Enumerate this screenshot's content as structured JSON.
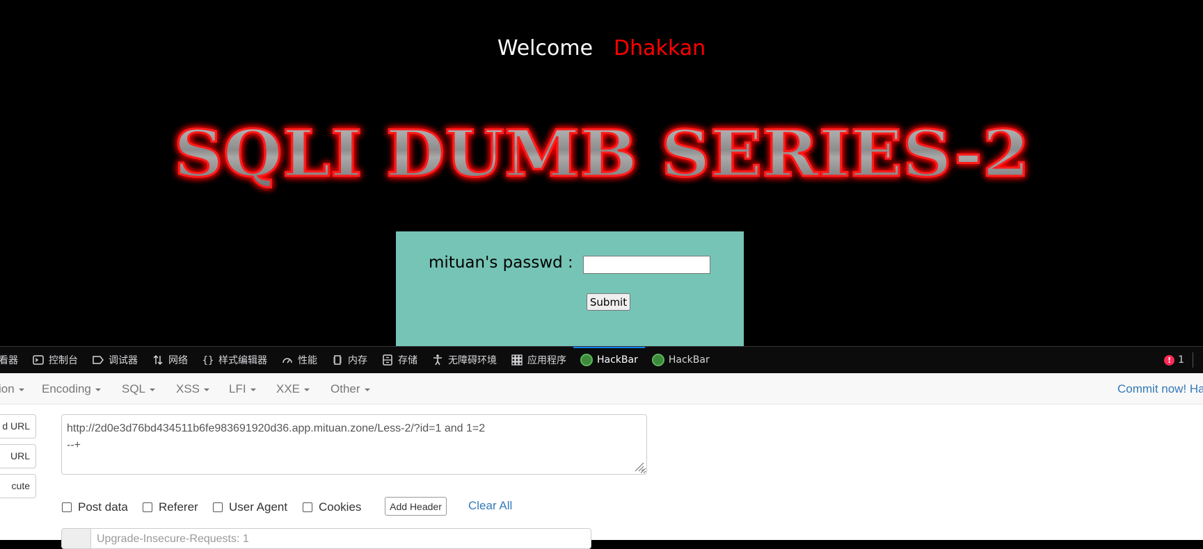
{
  "page": {
    "welcome": "Welcome",
    "name": "Dhakkan",
    "title": "SQLI DUMB SERIES-2",
    "password_label": "mituan's passwd :",
    "submit_label": "Submit"
  },
  "devtools": {
    "tabs": [
      {
        "label": "查看器",
        "icon": "inspector-icon"
      },
      {
        "label": "控制台",
        "icon": "console-icon"
      },
      {
        "label": "调试器",
        "icon": "debugger-icon"
      },
      {
        "label": "网络",
        "icon": "network-icon"
      },
      {
        "label": "样式编辑器",
        "icon": "style-editor-icon"
      },
      {
        "label": "性能",
        "icon": "performance-icon"
      },
      {
        "label": "内存",
        "icon": "memory-icon"
      },
      {
        "label": "存储",
        "icon": "storage-icon"
      },
      {
        "label": "无障碍环境",
        "icon": "accessibility-icon"
      },
      {
        "label": "应用程序",
        "icon": "application-icon"
      },
      {
        "label": "HackBar",
        "icon": "hackbar-icon",
        "active": true
      },
      {
        "label": "HackBar",
        "icon": "hackbar-icon"
      }
    ],
    "error_count": "1"
  },
  "hackbar": {
    "menu": {
      "encryption": "ion",
      "encoding": "Encoding",
      "sql": "SQL",
      "xss": "XSS",
      "lfi": "LFI",
      "xxe": "XXE",
      "other": "Other",
      "commit": "Commit now! Ha"
    },
    "buttons": {
      "load_url": "d URL",
      "split_url": "URL",
      "execute": "cute"
    },
    "url": "http://2d0e3d76bd434511b6fe983691920d36.app.mituan.zone/Less-2/?id=1 and 1=2\n--+",
    "options": {
      "post_data": "Post data",
      "referer": "Referer",
      "user_agent": "User Agent",
      "cookies": "Cookies",
      "add_header": "Add Header",
      "clear_all": "Clear All"
    },
    "header_placeholder": "Upgrade-Insecure-Requests: 1"
  },
  "colors": {
    "accent_red": "#ff0000",
    "login_bg": "#76c4b6",
    "link_blue": "#337ab7",
    "devtools_active": "#0a84ff"
  }
}
